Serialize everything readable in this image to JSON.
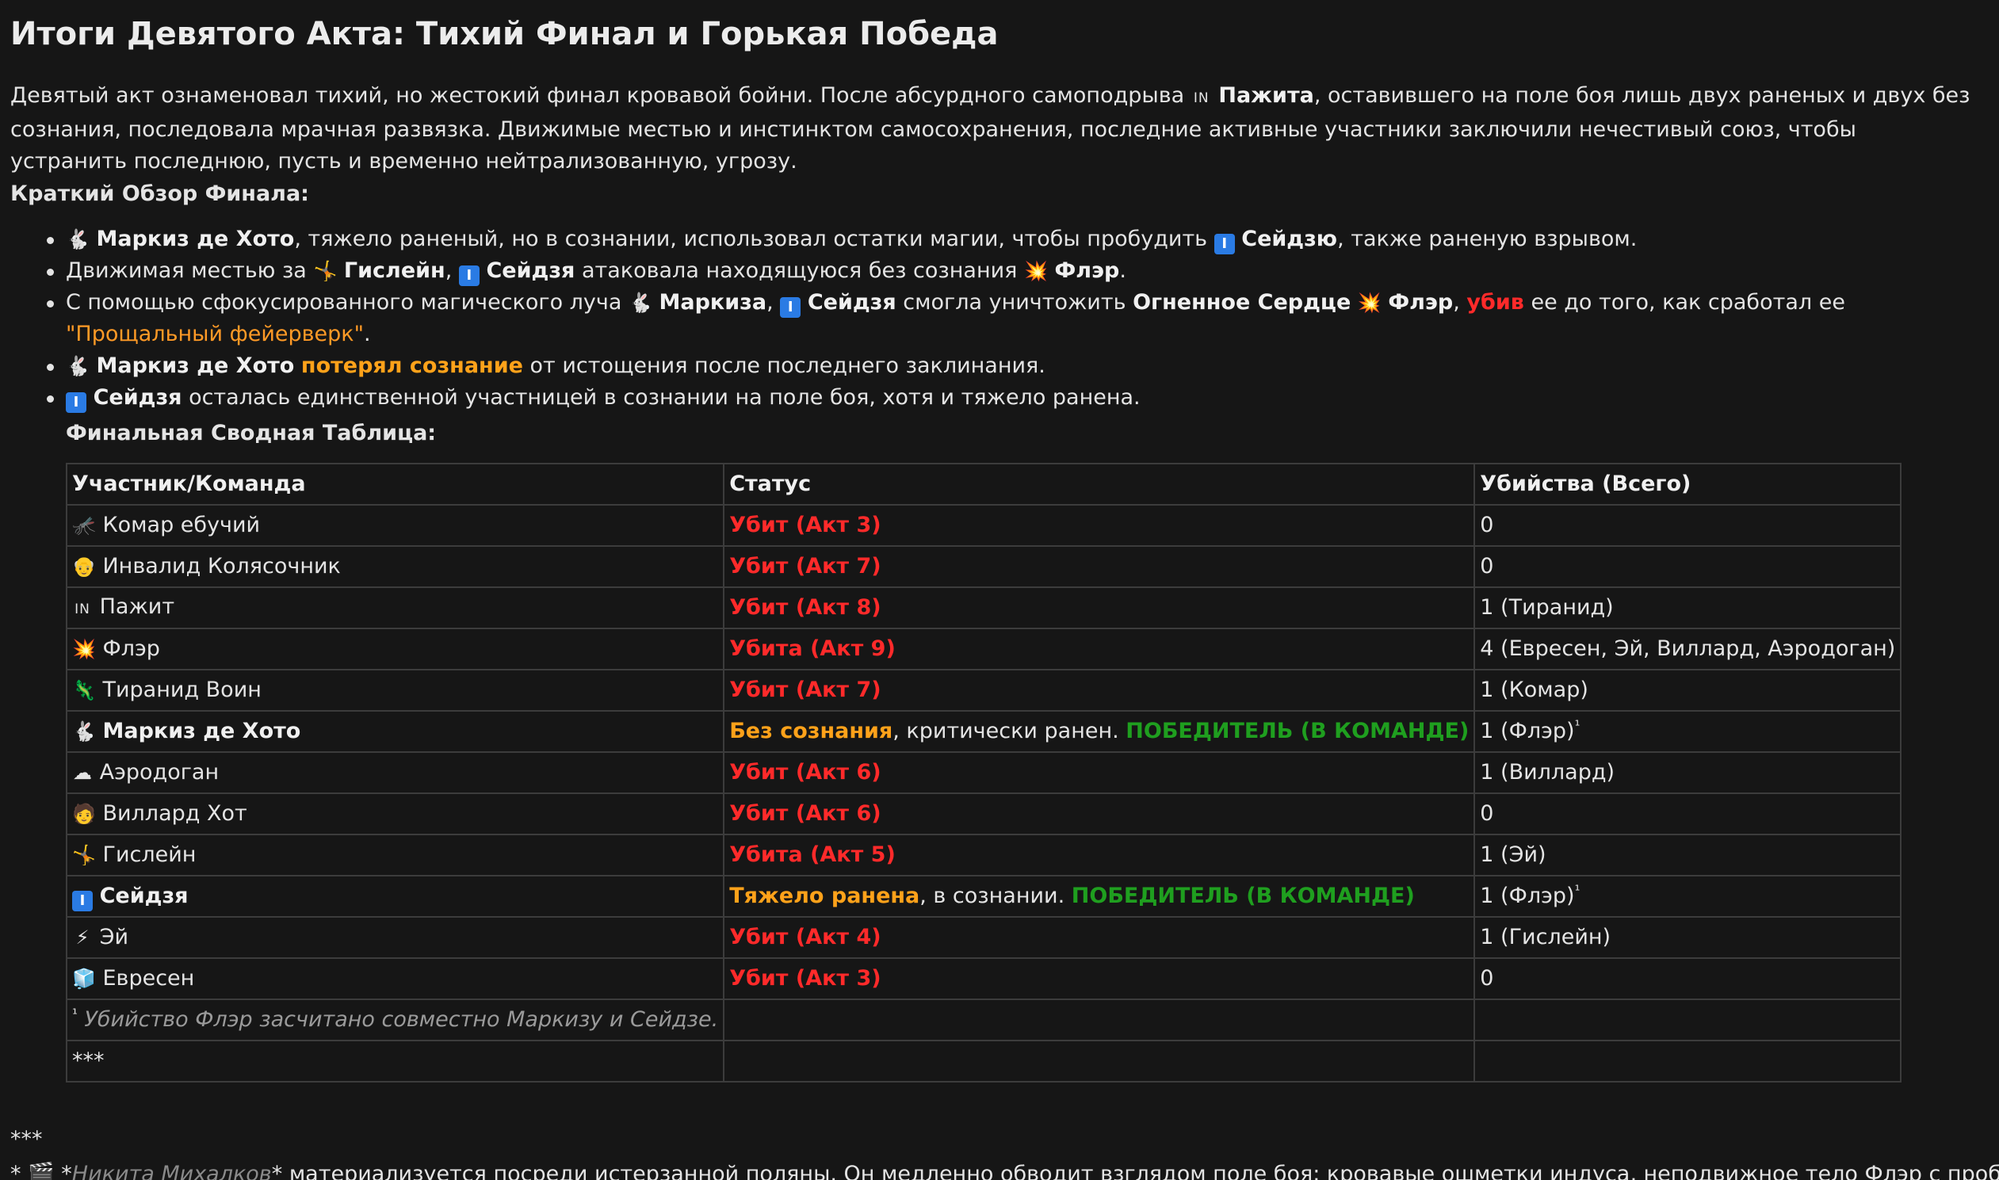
{
  "title": "Итоги Девятого Акта: Тихий Финал и Горькая Победа",
  "intro": {
    "part1": "Девятый акт ознаменовал тихий, но жестокий финал кровавой бойни. После абсурдного самоподрыва ",
    "icon_pazhit": "IN",
    "name": "Пажита",
    "part2": ", оставившего на поле боя лишь двух раненых и двух без сознания, последовала мрачная развязка. Движимые местью и инстинктом самосохранения, последние активные участники заключили нечестивый союз, чтобы устранить последнюю, пусть и временно нейтрализованную, угрозу."
  },
  "overview_title": "Краткий Обзор Финала:",
  "bullets": [
    {
      "icon1": "🐇",
      "name1": "Маркиз де Хото",
      "t1": ", тяжело раненый, но в сознании, использовал остатки магии, чтобы пробудить ",
      "icon2": "I",
      "name2": "Сейдзю",
      "t2": ", также раненую взрывом."
    },
    {
      "t0": "Движимая местью за ",
      "icon1": "🤸",
      "name1": "Гислейн",
      "t1": ", ",
      "icon2": "I",
      "name2": "Сейдзя",
      "t2": " атаковала находящуюся без сознания ",
      "icon3": "💥",
      "name3": "Флэр",
      "t3": "."
    },
    {
      "t0": "С помощью сфокусированного магического луча ",
      "icon1": "🐇",
      "name1": "Маркиза",
      "t1": ", ",
      "icon2": "I",
      "name2": "Сейдзя",
      "t2": " смогла уничтожить ",
      "name3": "Огненное Сердце",
      "t3": " ",
      "icon4": "💥",
      "name4": "Флэр",
      "t4": ", ",
      "red": "убив",
      "t5": " ее до того, как сработал ее ",
      "orange": "\"Прощальный фейерверк\"",
      "t6": "."
    },
    {
      "icon1": "🐇",
      "name1": "Маркиз де Хото",
      "t1": " ",
      "orange": "потерял сознание",
      "t2": " от истощения после последнего заклинания."
    },
    {
      "icon1": "I",
      "name1": "Сейдзя",
      "t1": " осталась единственной участницей в сознании на поле боя, хотя и тяжело ранена."
    }
  ],
  "table_title": "Финальная Сводная Таблица:",
  "table": {
    "headers": [
      "Участник/Команда",
      "Статус",
      "Убийства (Всего)"
    ],
    "rows": [
      {
        "icon": "🦟",
        "name": "Комар ебучий",
        "status": "Убит (Акт 3)",
        "kills": "0"
      },
      {
        "icon": "👴",
        "name": "Инвалид Колясочник",
        "status": "Убит (Акт 7)",
        "kills": "0"
      },
      {
        "icon": "IN",
        "name": "Пажит",
        "status": "Убит (Акт 8)",
        "kills": "1 (Тиранид)"
      },
      {
        "icon": "💥",
        "name": "Флэр",
        "status": "Убита (Акт 9)",
        "kills": "4 (Евресен, Эй, Виллард, Аэродоган)"
      },
      {
        "icon": "🦎",
        "name": "Тиранид Воин",
        "status": "Убит (Акт 7)",
        "kills": "1 (Комар)"
      },
      {
        "icon": "🐇",
        "name": "Маркиз де Хото",
        "status_orange": "Без сознания",
        "status_rest": ", критически ранен. ",
        "status_green": "ПОБЕДИТЕЛЬ (В КОМАНДЕ)",
        "kills": "1 (Флэр)",
        "kills_sup": "¹"
      },
      {
        "icon": "☁",
        "name": "Аэродоган",
        "status": "Убит (Акт 6)",
        "kills": "1 (Виллард)"
      },
      {
        "icon": "🧑",
        "name": "Виллард Хот",
        "status": "Убит (Акт 6)",
        "kills": "0"
      },
      {
        "icon": "🤸",
        "name": "Гислейн",
        "status": "Убита (Акт 5)",
        "kills": "1 (Эй)"
      },
      {
        "icon": "I",
        "name": "Сейдзя",
        "status_orange": "Тяжело ранена",
        "status_rest": ", в сознании. ",
        "status_green": "ПОБЕДИТЕЛЬ (В КОМАНДЕ)",
        "kills": "1 (Флэр)",
        "kills_sup": "¹"
      },
      {
        "icon": "⚡",
        "name": "Эй",
        "status": "Убит (Акт 4)",
        "kills": "1 (Гислейн)"
      },
      {
        "icon": "🧊",
        "name": "Евресен",
        "status": "Убит (Акт 3)",
        "kills": "0"
      }
    ],
    "footnote_mark": "¹",
    "footnote": "Убийство Флэр засчитано совместно Маркизу и Сейдзе.",
    "stars_row": "***"
  },
  "stars": "***",
  "bottom": {
    "prefix": "* 🎬 *",
    "name": "Никита Михалков",
    "text": "* материализуется посреди истерзанной поляны. Он медленно обводит взглядом поле боя: кровавые ошметки индуса, неподвижное тело Флэр с пробитой"
  }
}
